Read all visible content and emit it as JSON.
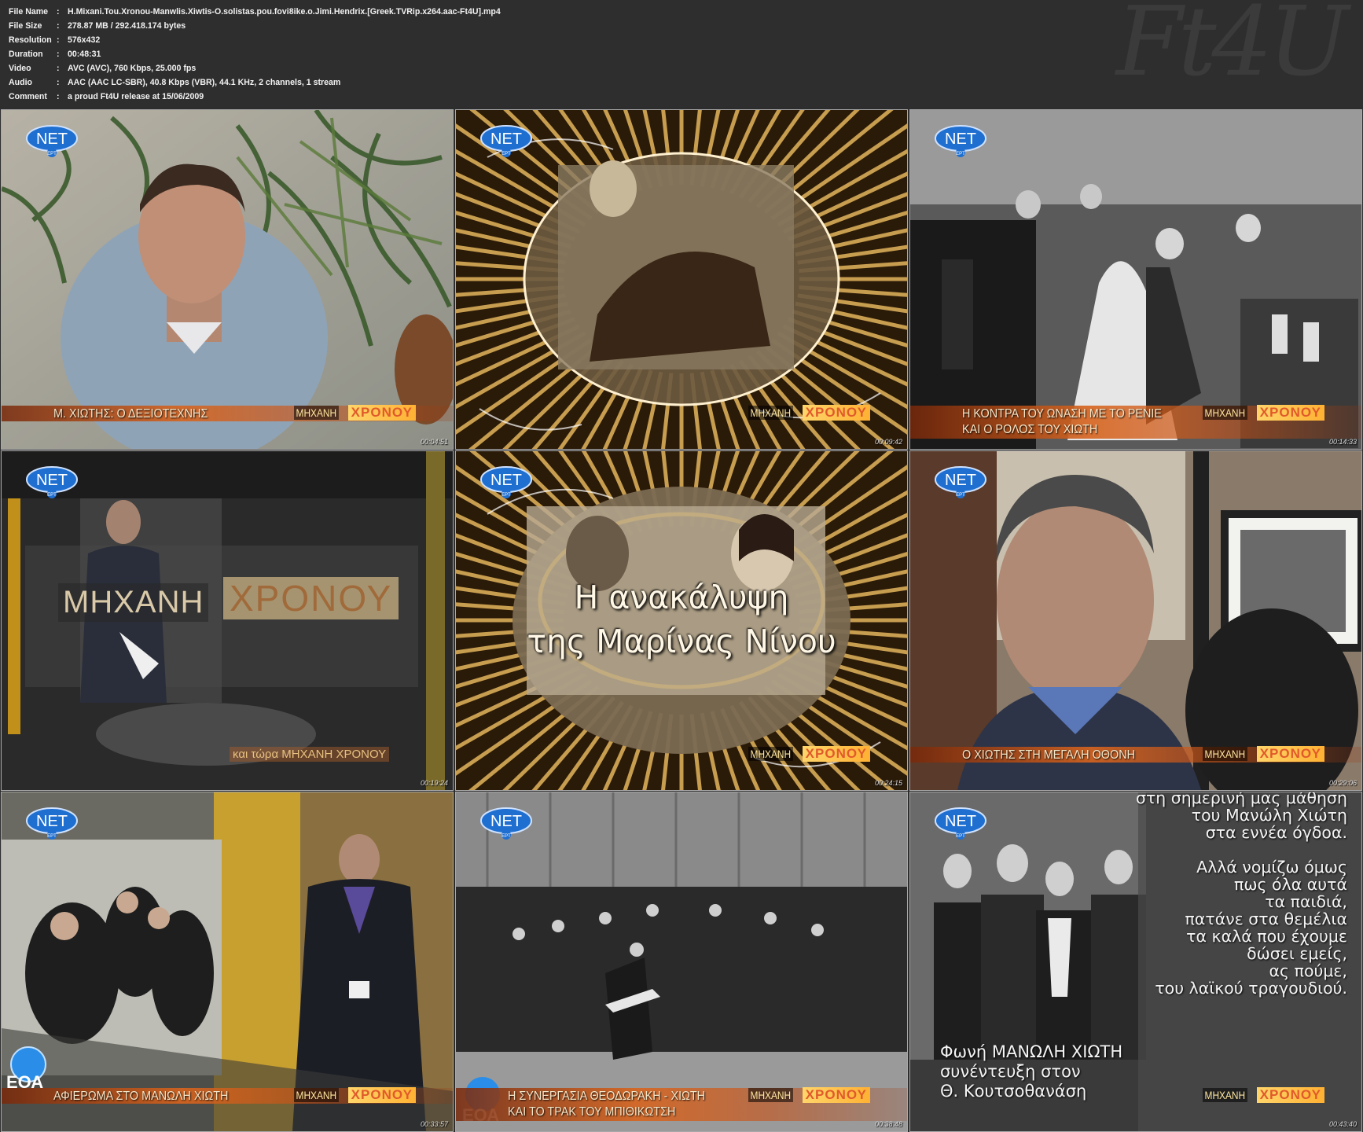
{
  "info": [
    {
      "label": "File Name",
      "sep": ":",
      "value": "H.Mixani.Tou.Xronou-Manwlis.Xiwtis-O.solistas.pou.fovi8ike.o.Jimi.Hendrix.[Greek.TVRip.x264.aac-Ft4U].mp4"
    },
    {
      "label": "File Size",
      "sep": ":",
      "value": "278.87 MB  /  292.418.174  bytes"
    },
    {
      "label": "Resolution",
      "sep": ":",
      "value": "576x432"
    },
    {
      "label": "Duration",
      "sep": ":",
      "value": "00:48:31"
    },
    {
      "label": "Video",
      "sep": ":",
      "value": "AVC (AVC), 760 Kbps, 25.000 fps"
    },
    {
      "label": "Audio",
      "sep": ":",
      "value": "AAC (AAC LC-SBR), 40.8 Kbps (VBR), 44.1 KHz, 2 channels, 1 stream"
    },
    {
      "label": "Comment",
      "sep": ":",
      "value": "a proud Ft4U release at 15/06/2009"
    }
  ],
  "watermark": "Ft4U",
  "channel_logo": {
    "name": "NET",
    "sub": "ΕΡΤ"
  },
  "show_logo": {
    "left": "ΜΗΧΑΝΗ",
    "right": "ΧΡΟΝΟΥ"
  },
  "thumbs": [
    {
      "caption": "Μ. ΧΙΩΤΗΣ: Ο ΔΕΞΙΟΤΕΧΝΗΣ",
      "time": "00:04:51"
    },
    {
      "caption": "",
      "time": "00:09:42"
    },
    {
      "caption": "Η ΚΟΝΤΡΑ ΤΟΥ ΩΝΑΣΗ ΜΕ ΤΟ ΡΕΝΙΕ",
      "caption2": "ΚΑΙ Ο ΡΟΛΟΣ ΤΟΥ ΧΙΩΤΗ",
      "time": "00:14:33"
    },
    {
      "caption": "",
      "time": "00:19:24",
      "big_logo_left": "ΜΗΧΑΝΗ",
      "big_logo_right": "ΧΡΟΝΟΥ",
      "small_text": "και τώρα ΜΗΧΑΝΗ ΧΡΟΝΟΥ"
    },
    {
      "caption": "",
      "time": "00:24:15",
      "title_line1": "Η ανακάλυψη",
      "title_line2": "της Μαρίνας Νίνου"
    },
    {
      "caption": "Ο ΧΙΩΤΗΣ ΣΤΗ ΜΕΓΑΛΗ ΟΘΟΝΗ",
      "time": "00:29:06"
    },
    {
      "caption": "ΑΦΙΕΡΩΜΑ ΣΤΟ ΜΑΝΩΛΗ ΧΙΩΤΗ",
      "time": "00:33:57",
      "bug": "ΕΟΑ"
    },
    {
      "caption": "Η ΣΥΝΕΡΓΑΣΙΑ ΘΕΟΔΩΡΑΚΗ - ΧΙΩΤΗ",
      "caption2": "ΚΑΙ ΤΟ ΤΡΑΚ ΤΟΥ ΜΠΙΘΙΚΩΤΣΗ",
      "time": "00:38:48",
      "bug": "ΕΟΑ"
    },
    {
      "caption": "",
      "time": "00:43:40",
      "subtitles": [
        "στη σημερινή μας μάθηση",
        "του Μανώλη Χιώτη",
        "στα εννέα όγδοα.",
        "",
        "Αλλά νομίζω όμως",
        "πως όλα αυτά",
        "τα παιδιά,",
        "πατάνε στα θεμέλια",
        "τα καλά που έχουμε",
        "δώσει εμείς,",
        "ας πούμε,",
        "του λαϊκού τραγουδιού."
      ],
      "voice": [
        "Φωνή ΜΑΝΩΛΗ ΧΙΩΤΗ",
        "συνέντευξη στον",
        "Θ. Κουτσοθανάση"
      ]
    }
  ]
}
